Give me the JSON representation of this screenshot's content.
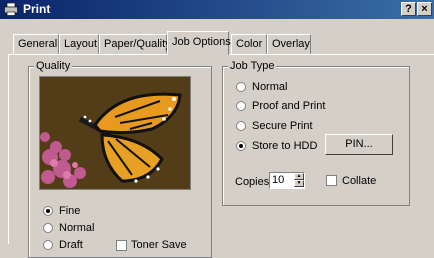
{
  "window": {
    "title": "Print",
    "help_label": "?",
    "close_label": "×"
  },
  "tabs": [
    {
      "label": "General",
      "active": false
    },
    {
      "label": "Layout",
      "active": false
    },
    {
      "label": "Paper/Quality",
      "active": false
    },
    {
      "label": "Job Options",
      "active": true
    },
    {
      "label": "Color",
      "active": false
    },
    {
      "label": "Overlay",
      "active": false
    }
  ],
  "quality": {
    "legend": "Quality",
    "options": [
      {
        "label": "Fine",
        "selected": true
      },
      {
        "label": "Normal",
        "selected": false
      },
      {
        "label": "Draft",
        "selected": false
      }
    ],
    "toner_save_label": "Toner Save"
  },
  "job_type": {
    "legend": "Job Type",
    "options": [
      {
        "label": "Normal",
        "selected": false
      },
      {
        "label": "Proof and Print",
        "selected": false
      },
      {
        "label": "Secure Print",
        "selected": false
      },
      {
        "label": "Store to HDD",
        "selected": true
      }
    ],
    "pin_button": "PIN...",
    "copies_label": "Copies",
    "copies_value": "10",
    "collate_label": "Collate",
    "collate_checked": false
  }
}
